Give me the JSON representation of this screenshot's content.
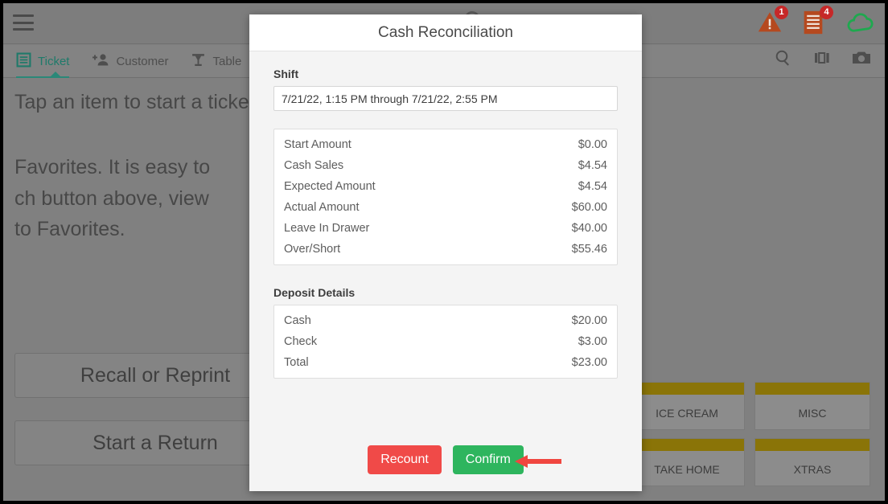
{
  "appbar": {
    "menu_icon": "hamburger-menu-icon",
    "right_icons": [
      {
        "name": "alert-warning-icon",
        "badge": "1"
      },
      {
        "name": "receipt-icon",
        "badge": "4"
      },
      {
        "name": "cloud-sync-icon",
        "badge": ""
      }
    ]
  },
  "tabs": [
    {
      "label": "Ticket",
      "icon": "ticket-list-icon",
      "active": true
    },
    {
      "label": "Customer",
      "icon": "add-customer-icon",
      "active": false
    },
    {
      "label": "Table",
      "icon": "table-icon",
      "active": false
    }
  ],
  "toolbar_icons": [
    {
      "name": "search-icon"
    },
    {
      "name": "view-column-icon"
    },
    {
      "name": "camera-icon"
    }
  ],
  "background": {
    "line1": "Tap an item to start a ticket.",
    "line2_a": "Favorites. It is easy to",
    "line3_a": "ch button above, view",
    "line3_b": "to Favorites.",
    "buttons": [
      {
        "label": "Recall or Reprint"
      },
      {
        "label": "Start a Return"
      }
    ],
    "categories": [
      {
        "label": "ICE CREAM"
      },
      {
        "label": "MISC"
      },
      {
        "label": "TAKE HOME"
      },
      {
        "label": "XTRAS"
      }
    ],
    "category_cap_color": "#8a7408"
  },
  "dialog": {
    "title": "Cash Reconciliation",
    "shift_label": "Shift",
    "shift_value": "7/21/22, 1:15 PM through 7/21/22, 2:55 PM",
    "amounts": [
      {
        "label": "Start Amount",
        "value": "$0.00"
      },
      {
        "label": "Cash Sales",
        "value": "$4.54"
      },
      {
        "label": "Expected Amount",
        "value": "$4.54"
      },
      {
        "label": "Actual Amount",
        "value": "$60.00"
      },
      {
        "label": "Leave In Drawer",
        "value": "$40.00"
      },
      {
        "label": "Over/Short",
        "value": "$55.46"
      }
    ],
    "deposit_label": "Deposit Details",
    "deposit": [
      {
        "label": "Cash",
        "value": "$20.00"
      },
      {
        "label": "Check",
        "value": "$3.00"
      },
      {
        "label": "Total",
        "value": "$23.00"
      }
    ],
    "recount_label": "Recount",
    "confirm_label": "Confirm",
    "recount_color": "#f04a48",
    "confirm_color": "#2eb55e"
  },
  "annotation": {
    "arrow_color": "#f0463f",
    "points_to": "Confirm"
  }
}
